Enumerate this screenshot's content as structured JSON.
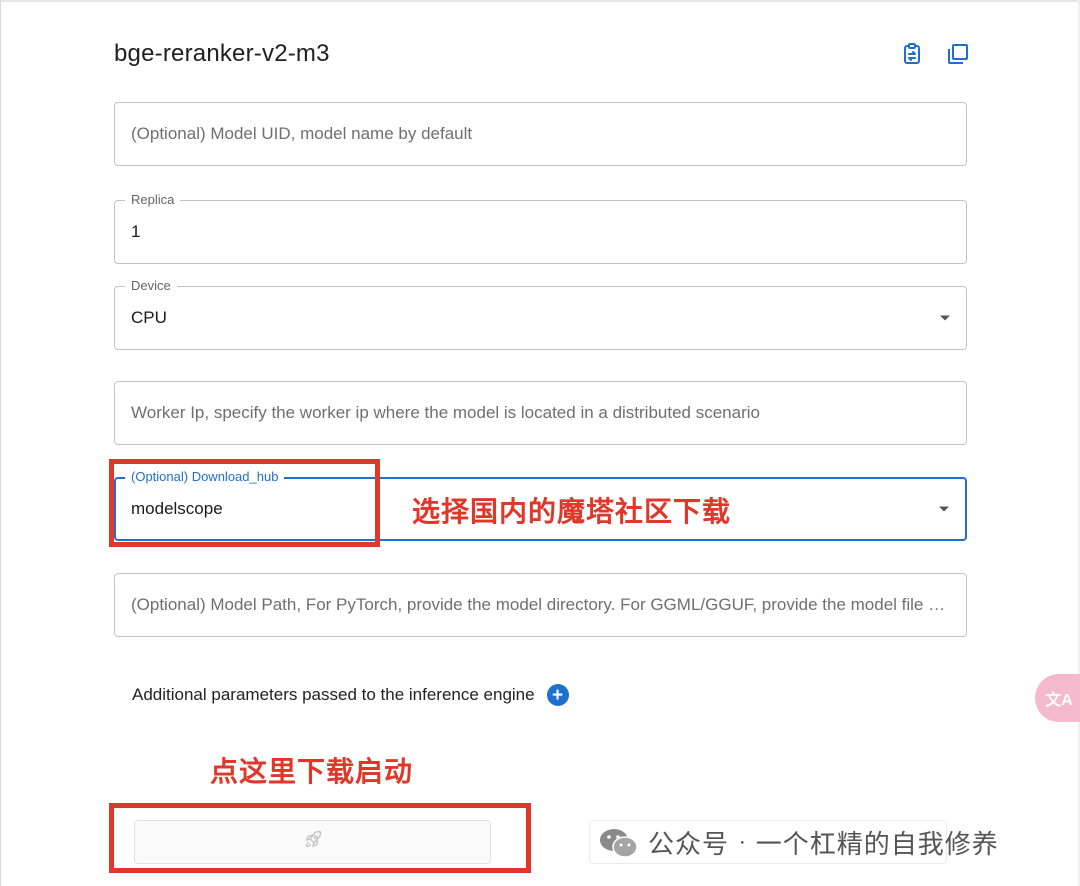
{
  "header": {
    "title": "bge-reranker-v2-m3",
    "icons": [
      "clipboard-swap-icon",
      "copy-icon"
    ]
  },
  "form": {
    "model_uid": {
      "placeholder": "(Optional) Model UID, model name by default"
    },
    "replica": {
      "label": "Replica",
      "value": "1"
    },
    "device": {
      "label": "Device",
      "value": "CPU"
    },
    "worker_ip": {
      "placeholder": "Worker Ip, specify the worker ip where the model is located in a distributed scenario"
    },
    "download_hub": {
      "label": "(Optional) Download_hub",
      "value": "modelscope"
    },
    "model_path": {
      "placeholder": "(Optional) Model Path, For PyTorch, provide the model directory. For GGML/GGUF, provide the model file path."
    },
    "additional_params_label": "Additional parameters passed to the inference engine",
    "launch_icon": "rocket-icon"
  },
  "annotations": {
    "hub_note": "选择国内的魔塔社区下载",
    "launch_note": "点这里下载启动"
  },
  "watermark": {
    "prefix": "公众号",
    "separator": "·",
    "name": "一个杠精的自我修养"
  },
  "colors": {
    "accent": "#1f6fd1",
    "annotation": "#e0372a",
    "fab": "#f4b9cc"
  }
}
